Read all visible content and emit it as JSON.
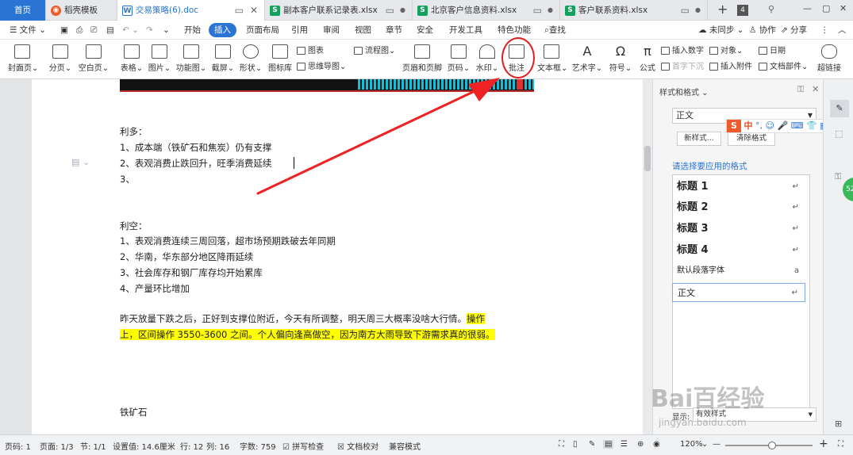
{
  "tabs": [
    {
      "label": "首页",
      "active": true
    },
    {
      "label": "稻壳模板",
      "icon": "docer-icon"
    },
    {
      "label": "交易策略(6).doc",
      "icon": "word-icon",
      "current": true
    },
    {
      "label": "副本客户联系记录表.xlsx",
      "icon": "sheet-icon"
    },
    {
      "label": "北京客户信息资料.xlsx",
      "icon": "sheet-icon"
    },
    {
      "label": "客户联系资料.xlsx",
      "icon": "sheet-icon"
    }
  ],
  "tab_counter": "4",
  "menu": {
    "file": "文件",
    "items": [
      "开始",
      "插入",
      "页面布局",
      "引用",
      "审阅",
      "视图",
      "章节",
      "安全",
      "开发工具",
      "特色功能"
    ],
    "active": "插入",
    "search": "查找",
    "sync": "未同步",
    "collab": "协作",
    "share": "分享"
  },
  "ribbon": {
    "big": [
      "封面页",
      "分页",
      "空白页",
      "表格",
      "图片",
      "功能图",
      "截屏",
      "形状",
      "图标库",
      "页眉和页脚",
      "页码",
      "水印",
      "批注",
      "文本框",
      "艺术字",
      "符号",
      "公式",
      "超链接"
    ],
    "small": {
      "chart": "图表",
      "mindmap": "思维导图",
      "flowchart": "流程图",
      "object": "对象",
      "insert_number": "插入数字",
      "first_sink": "首字下沉",
      "attachment": "插入附件",
      "date": "日期",
      "doc_part": "文档部件"
    }
  },
  "document": {
    "bullish_title": "利多：",
    "bullish": [
      "1、成本端（铁矿石和焦炭）仍有支撑",
      "2、表观消费止跌回升，旺季消费延续",
      "3、"
    ],
    "bearish_title": "利空：",
    "bearish": [
      "1、表观消费连续三周回落，超市场预期跌破去年同期",
      "2、华南，华东部分地区降雨延续",
      "3、社会库存和钢厂库存均开始累库",
      "4、产量环比增加"
    ],
    "para_plain": "昨天放量下跌之后，正好到支撑位附近，今天有所调整，明天周三大概率没啥大行情。",
    "para_hl_1": "操作",
    "para_hl_2": "上，区间操作 3550-3600 之间。个人偏向逢高做空，因为南方大雨导致下游需求真的很弱。",
    "iron_ore": "铁矿石"
  },
  "styles_pane": {
    "title": "样式和格式",
    "current": "正文",
    "new_style": "新样式...",
    "clear_format": "清除格式",
    "prompt": "请选择要应用的格式",
    "items": [
      "标题 1",
      "标题 2",
      "标题 3",
      "标题 4",
      "默认段落字体",
      "正文"
    ],
    "show_label": "显示:",
    "show_value": "有效样式"
  },
  "ime": {
    "mode": "中"
  },
  "status": {
    "page": "页码: 1",
    "pages": "页面: 1/3",
    "section": "节: 1/1",
    "setting": "设置值: 14.6厘米",
    "row": "行: 12",
    "col": "列: 16",
    "words": "字数: 759",
    "spell": "拼写检查",
    "proof": "文档校对",
    "compat": "兼容模式",
    "zoom": "120%"
  },
  "watermark": {
    "brand": "Bai百经验",
    "url": "jingyan.baidu.com"
  },
  "colors": {
    "accent": "#2a75d3",
    "highlight": "#ffff00",
    "arrow": "#ee2222"
  }
}
